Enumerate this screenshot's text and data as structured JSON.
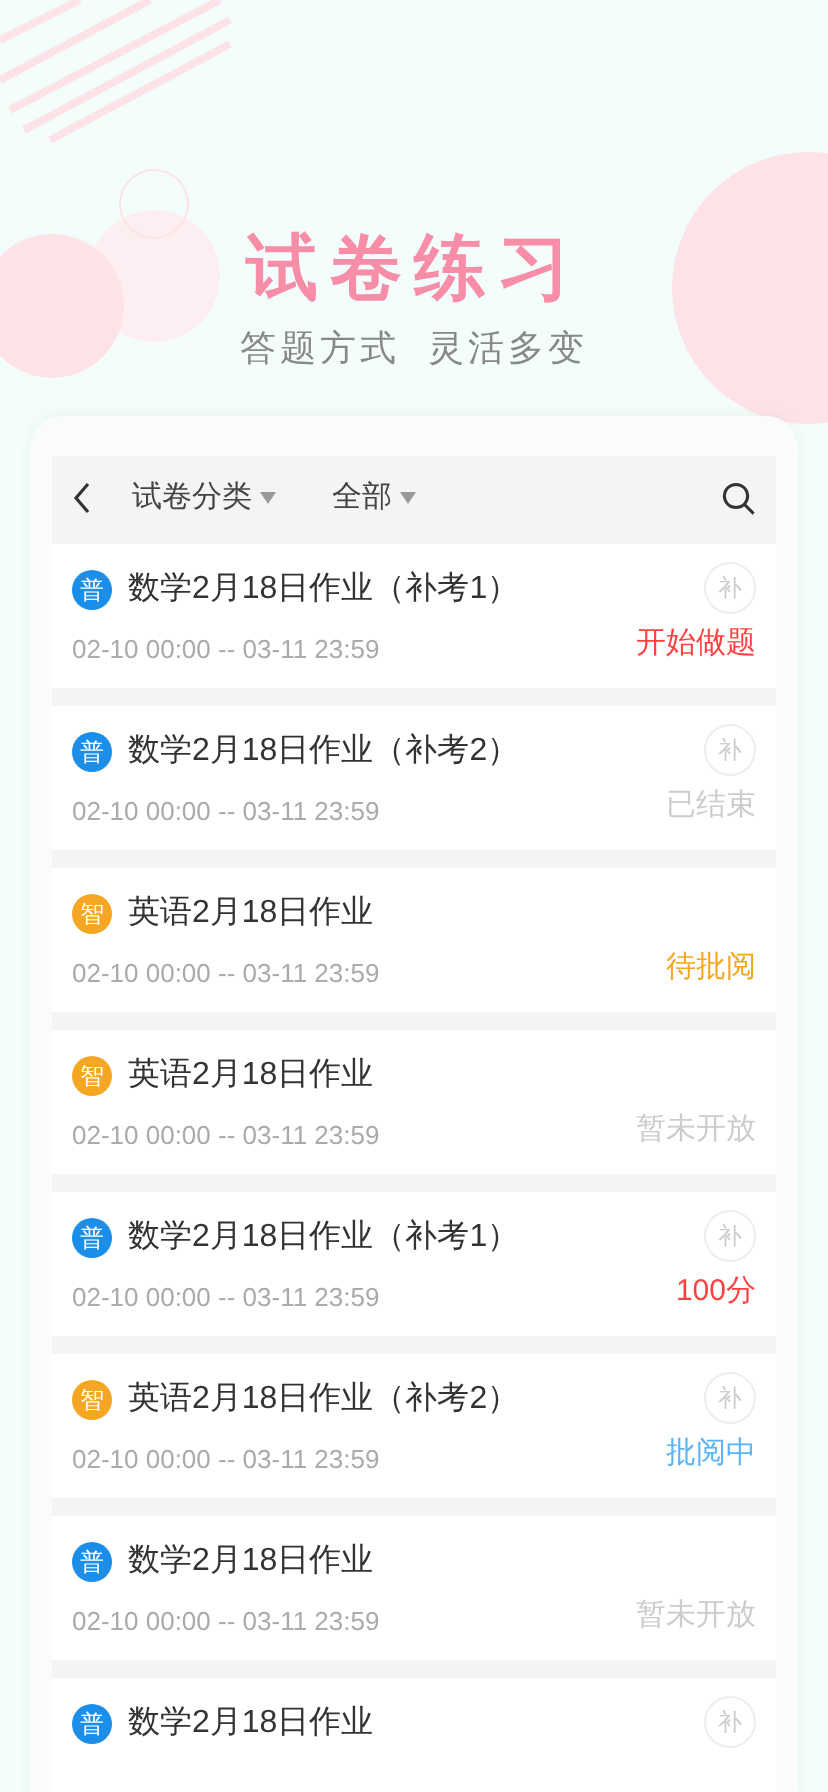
{
  "header": {
    "title": "试卷练习",
    "subtitle": "答题方式  灵活多变"
  },
  "toolbar": {
    "filters": [
      {
        "label": "试卷分类"
      },
      {
        "label": "全部"
      }
    ]
  },
  "exams": [
    {
      "badge": {
        "text": "普",
        "kind": "normal"
      },
      "title": "数学2月18日作业（补考1）",
      "time": "02-10 00:00 -- 03-11 23:59",
      "makeup": "补",
      "status": {
        "text": "开始做题",
        "kind": "start"
      }
    },
    {
      "badge": {
        "text": "普",
        "kind": "normal"
      },
      "title": "数学2月18日作业（补考2）",
      "time": "02-10 00:00 -- 03-11 23:59",
      "makeup": "补",
      "status": {
        "text": "已结束",
        "kind": "ended"
      }
    },
    {
      "badge": {
        "text": "智",
        "kind": "smart"
      },
      "title": "英语2月18日作业",
      "time": "02-10 00:00 -- 03-11 23:59",
      "status": {
        "text": "待批阅",
        "kind": "pending"
      }
    },
    {
      "badge": {
        "text": "智",
        "kind": "smart"
      },
      "title": "英语2月18日作业",
      "time": "02-10 00:00 -- 03-11 23:59",
      "status": {
        "text": "暂未开放",
        "kind": "closed"
      }
    },
    {
      "badge": {
        "text": "普",
        "kind": "normal"
      },
      "title": "数学2月18日作业（补考1）",
      "time": "02-10 00:00 -- 03-11 23:59",
      "makeup": "补",
      "status": {
        "text": "100分",
        "kind": "score"
      }
    },
    {
      "badge": {
        "text": "智",
        "kind": "smart"
      },
      "title": "英语2月18日作业（补考2）",
      "time": "02-10 00:00 -- 03-11 23:59",
      "makeup": "补",
      "status": {
        "text": "批阅中",
        "kind": "reviewing"
      }
    },
    {
      "badge": {
        "text": "普",
        "kind": "normal"
      },
      "title": "数学2月18日作业",
      "time": "02-10 00:00 -- 03-11 23:59",
      "status": {
        "text": "暂未开放",
        "kind": "closed"
      }
    },
    {
      "badge": {
        "text": "普",
        "kind": "normal"
      },
      "title": "数学2月18日作业",
      "makeup": "补"
    }
  ]
}
